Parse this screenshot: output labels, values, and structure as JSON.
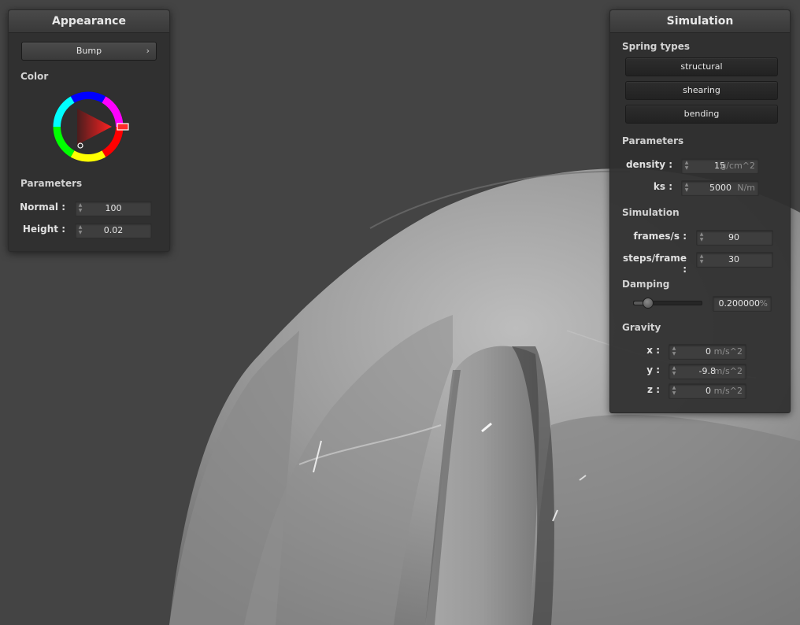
{
  "appearance": {
    "title": "Appearance",
    "shader_button": "Bump",
    "chevron_icon": "chevron-right-icon",
    "color_label": "Color",
    "color_wheel_icon": "color-wheel-icon",
    "selected_color": "#ff0000",
    "parameters_label": "Parameters",
    "normal": {
      "label": "Normal :",
      "value": "100"
    },
    "height": {
      "label": "Height :",
      "value": "0.02"
    }
  },
  "simulation": {
    "title": "Simulation",
    "spring_types_label": "Spring types",
    "spring_buttons": [
      "structural",
      "shearing",
      "bending"
    ],
    "parameters_label": "Parameters",
    "density": {
      "label": "density :",
      "value": "15",
      "unit": "g/cm^2"
    },
    "ks": {
      "label": "ks :",
      "value": "5000",
      "unit": "N/m"
    },
    "simulation_label": "Simulation",
    "frames": {
      "label": "frames/s :",
      "value": "90"
    },
    "steps": {
      "label": "steps/frame :",
      "value": "30"
    },
    "damping_label": "Damping",
    "damping": {
      "value": "0.200000",
      "unit": "%",
      "slider_fraction": 0.2
    },
    "gravity_label": "Gravity",
    "gravity": {
      "x": {
        "label": "x :",
        "value": "0",
        "unit": "m/s^2"
      },
      "y": {
        "label": "y :",
        "value": "-9.8",
        "unit": "m/s^2"
      },
      "z": {
        "label": "z :",
        "value": "0",
        "unit": "m/s^2"
      }
    }
  },
  "scene": {
    "background": "#444444",
    "object": "cloth-sphere-render"
  }
}
